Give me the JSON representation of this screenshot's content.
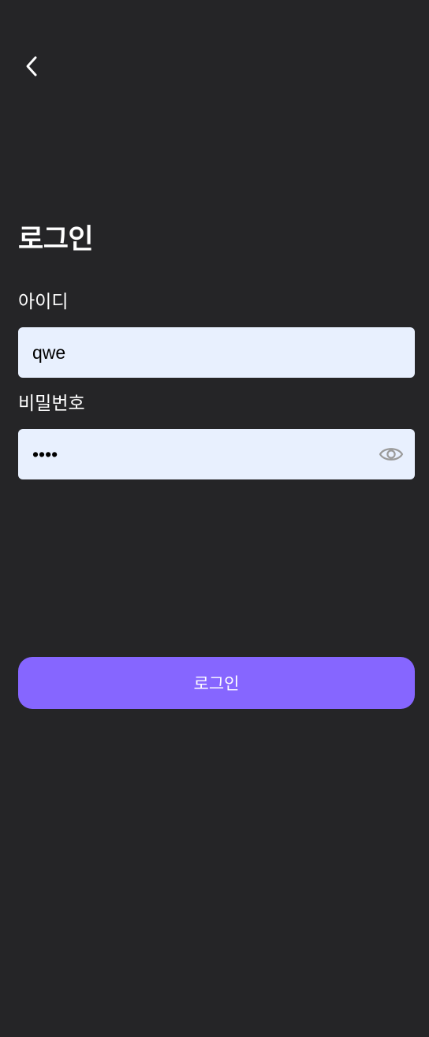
{
  "header": {
    "back_icon": "chevron-left-icon"
  },
  "login": {
    "title": "로그인",
    "id_label": "아이디",
    "id_value": "qwe",
    "password_label": "비밀번호",
    "password_value": "1234",
    "password_toggle_icon": "eye-icon",
    "submit_label": "로그인"
  },
  "colors": {
    "background": "#252527",
    "input_background": "#e8f0fe",
    "accent": "#8666ff",
    "icon_muted": "#9a9a9a"
  }
}
